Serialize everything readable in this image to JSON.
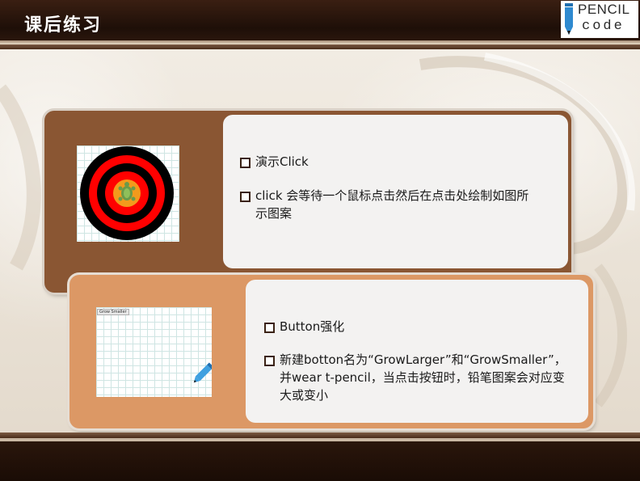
{
  "slide": {
    "title": "课后练习",
    "logo": {
      "line1": "PENCIL",
      "line2": "code"
    }
  },
  "panel1": {
    "bullets": [
      {
        "text": "演示Click"
      },
      {
        "text": "click 会等待一个鼠标点击然后在点击处绘制如图所示图案"
      }
    ],
    "image": {
      "description_icon": "target-with-turtle-icon"
    }
  },
  "panel2": {
    "bullets": [
      {
        "text": "Button强化"
      },
      {
        "text": "新建botton名为“GrowLarger”和“GrowSmaller”，并wear t-pencil，当点击按钮时，铅笔图案会对应变大或变小"
      }
    ],
    "image": {
      "button_label": "Grow Smaller",
      "description_icon": "pencil-icon"
    }
  },
  "colors": {
    "header": "#1e0f08",
    "panel1": "#8a5633",
    "panel2": "#dc9865",
    "text_box": "#f3f2f1"
  }
}
